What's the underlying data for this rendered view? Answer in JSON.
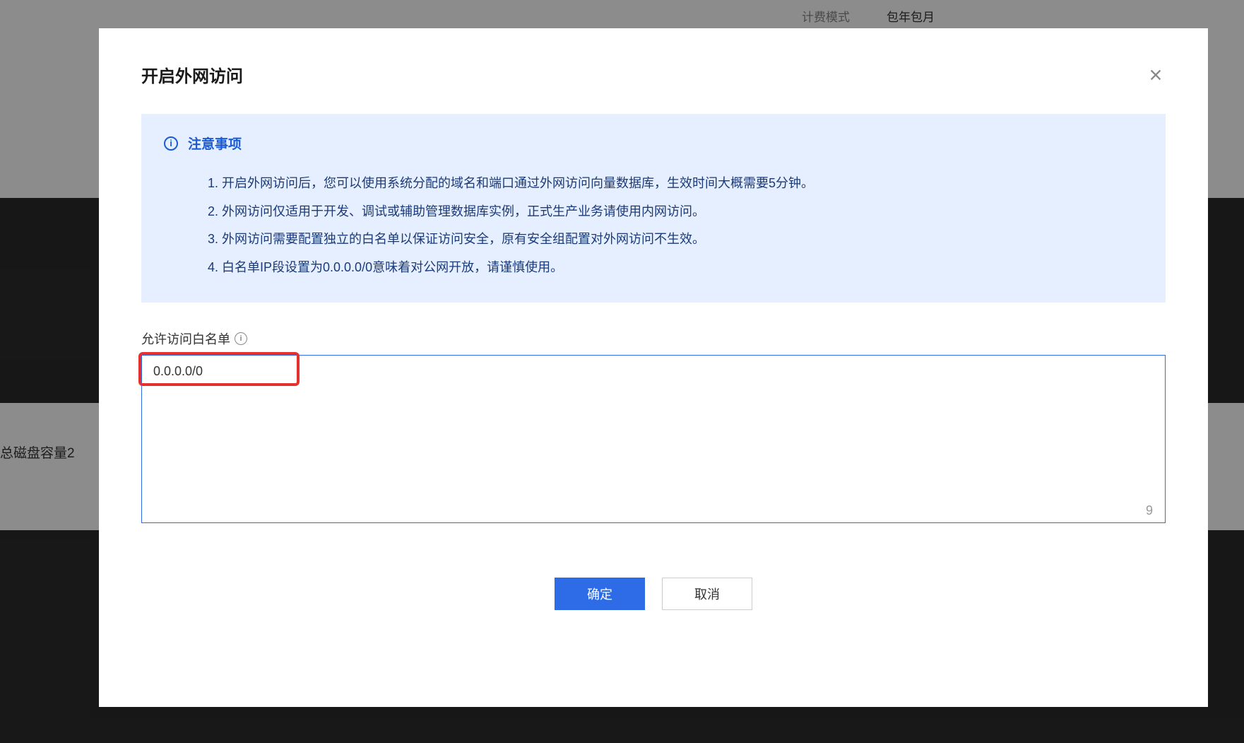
{
  "background": {
    "billing_label": "计费模式",
    "billing_value": "包年包月",
    "disk_label": "总磁盘容量2"
  },
  "modal": {
    "title": "开启外网访问",
    "notice": {
      "heading": "注意事项",
      "items": [
        "1. 开启外网访问后，您可以使用系统分配的域名和端口通过外网访问向量数据库，生效时间大概需要5分钟。",
        "2. 外网访问仅适用于开发、调试或辅助管理数据库实例，正式生产业务请使用内网访问。",
        "3. 外网访问需要配置独立的白名单以保证访问安全，原有安全组配置对外网访问不生效。",
        "4. 白名单IP段设置为0.0.0.0/0意味着对公网开放，请谨慎使用。"
      ]
    },
    "whitelist": {
      "label": "允许访问白名单",
      "value": "0.0.0.0/0",
      "char_count": "9"
    },
    "buttons": {
      "confirm": "确定",
      "cancel": "取消"
    }
  }
}
